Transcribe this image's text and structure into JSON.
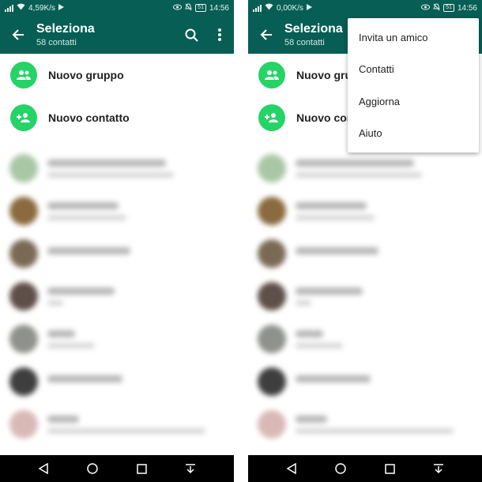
{
  "status": {
    "speed_left": "4,59K/s",
    "speed_right": "0,00K/s",
    "battery": "51",
    "time": "14:56"
  },
  "appbar": {
    "title": "Seleziona",
    "subtitle": "58 contatti"
  },
  "actions": {
    "new_group": "Nuovo gruppo",
    "new_contact": "Nuovo contatto"
  },
  "menu": {
    "items": [
      {
        "label": "Invita un amico"
      },
      {
        "label": "Contatti"
      },
      {
        "label": "Aggiorna"
      },
      {
        "label": "Aiuto"
      }
    ]
  },
  "colors": {
    "header": "#075e54",
    "accent": "#25d366",
    "navbar": "#000000"
  },
  "icons": {
    "back": "arrow-back-icon",
    "search": "search-icon",
    "more": "more-vert-icon",
    "group": "group-icon",
    "add_contact": "person-add-icon",
    "nav_back": "triangle-back-icon",
    "nav_home": "circle-home-icon",
    "nav_recents": "square-recents-icon",
    "nav_notifications": "pull-down-icon"
  }
}
